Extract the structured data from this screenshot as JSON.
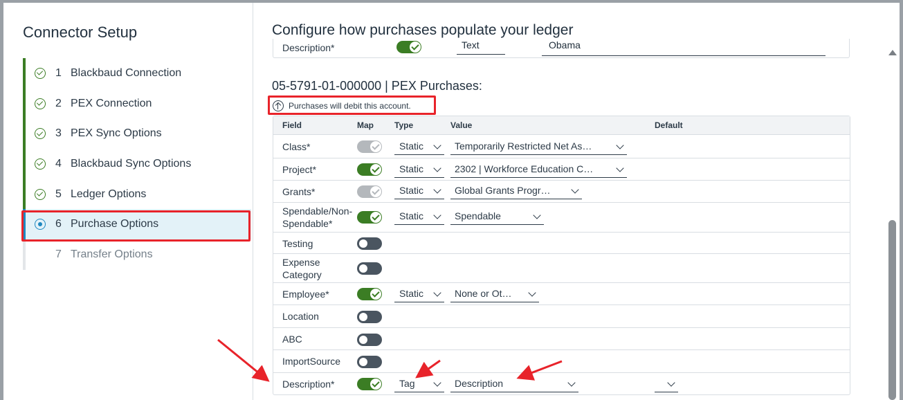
{
  "sidebar": {
    "title": "Connector Setup",
    "steps": [
      {
        "num": "1",
        "label": "Blackbaud Connection",
        "state": "done"
      },
      {
        "num": "2",
        "label": "PEX Connection",
        "state": "done"
      },
      {
        "num": "3",
        "label": "PEX Sync Options",
        "state": "done"
      },
      {
        "num": "4",
        "label": "Blackbaud Sync Options",
        "state": "done"
      },
      {
        "num": "5",
        "label": "Ledger Options",
        "state": "done"
      },
      {
        "num": "6",
        "label": "Purchase Options",
        "state": "current"
      },
      {
        "num": "7",
        "label": "Transfer Options",
        "state": "pending"
      }
    ]
  },
  "main": {
    "title": "Configure how purchases populate your ledger",
    "prev_row": {
      "field": "Description*",
      "type": "Text",
      "value": "Obama"
    },
    "section_title": "05-5791-01-000000 | PEX Purchases:",
    "debit_note": "Purchases will debit this account.",
    "columns": {
      "field": "Field",
      "map": "Map",
      "type": "Type",
      "value": "Value",
      "default": "Default"
    },
    "rows": [
      {
        "field": "Class*",
        "map": "on-disabled",
        "type": "Static",
        "value": "Temporarily Restricted Net As…"
      },
      {
        "field": "Project*",
        "map": "on",
        "type": "Static",
        "value": "2302 | Workforce Education C…"
      },
      {
        "field": "Grants*",
        "map": "on-disabled",
        "type": "Static",
        "value": "Global Grants Progr…"
      },
      {
        "field": "Spendable/Non-Spendable*",
        "map": "on",
        "type": "Static",
        "value": "Spendable"
      },
      {
        "field": "Testing",
        "map": "off"
      },
      {
        "field": "Expense Category",
        "map": "off"
      },
      {
        "field": "Employee*",
        "map": "on",
        "type": "Static",
        "value": "None or Ot…"
      },
      {
        "field": "Location",
        "map": "off"
      },
      {
        "field": "ABC",
        "map": "off"
      },
      {
        "field": "ImportSource",
        "map": "off"
      },
      {
        "field": "Description*",
        "map": "on",
        "type": "Tag",
        "value": "Description"
      }
    ]
  },
  "colors": {
    "accent_green": "#3b7d24",
    "active_blue": "#1e88c0",
    "highlight_red": "#e8232a"
  }
}
